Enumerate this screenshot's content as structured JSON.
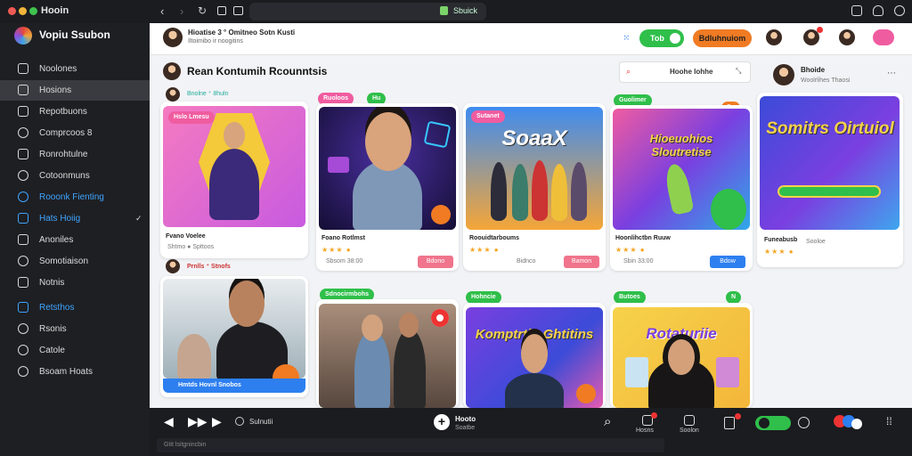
{
  "window": {
    "app_name": "Hooin",
    "url_label": "Sbuick"
  },
  "sidebar": {
    "title": "Vopiu Ssubon",
    "items": [
      {
        "label": "Noolones"
      },
      {
        "label": "Hosions"
      },
      {
        "label": "Repotbuons"
      },
      {
        "label": "Comprcoos 8"
      },
      {
        "label": "Ronrohtulne"
      },
      {
        "label": "Cotoonmuns"
      },
      {
        "label": "Rooonk Fienting"
      },
      {
        "label": "Hats Hoiig"
      },
      {
        "label": "Anoniles"
      },
      {
        "label": "Somotiaison"
      },
      {
        "label": "Notnis"
      },
      {
        "label": "Retsthos"
      },
      {
        "label": "Rsonis"
      },
      {
        "label": "Catole"
      },
      {
        "label": "Bsoam Hoats"
      }
    ]
  },
  "header": {
    "channel_title": "Hioatise 3 ° Omitneo Sotn Kusti",
    "channel_sub": "Iltoimibo ir noogitins",
    "toggle_label": "Tob",
    "cta_label": "Bdluhnuiom"
  },
  "section": {
    "title": "Rean Kontumih Rcounntsis",
    "subtitle": "Bnolne ⁺ 8huln",
    "search_placeholder": "Hoohe Iohhe",
    "row2_label": "Prnlls ⁺ Stnofs"
  },
  "profile": {
    "name": "Bhoide",
    "sub": "Woolrlihes Thaosi"
  },
  "cards": [
    {
      "tag": "Hslo Lmesu",
      "title": "Fvano Voelee",
      "meta": "Shtmo   ● Spttoos",
      "button": ""
    },
    {
      "tag": "Ruoloos",
      "tag2": "Hu",
      "title": "Foano Rotlmst",
      "meta": "Sbsom  38:00",
      "button": "Bdono",
      "poster": ""
    },
    {
      "tag": "Sutanet",
      "title": "Roouidtarboums",
      "meta": "Bidnco",
      "button": "Bamon",
      "poster": "SoaaX"
    },
    {
      "tag": "Guolimer",
      "tag2": "Sa",
      "title": "Hoonlihctbn Ruuw",
      "meta": "Sbin  33:00",
      "button": "Bdow",
      "poster": "Hioeuohios Sloutretise"
    },
    {
      "tag": "",
      "title": "Funeabusb",
      "meta": "Sooloe",
      "button": "",
      "poster": "Somitrs Oirtuiol"
    },
    {
      "tag": "",
      "title": "Hmtds  Hovnl  Snobos",
      "meta": "",
      "button": "",
      "poster": ""
    },
    {
      "tag": "Sdnocirmbohs",
      "title": "",
      "meta": "",
      "button": "",
      "poster": ""
    },
    {
      "tag": "Hohncie",
      "title": "",
      "meta": "",
      "button": "",
      "poster": "Komptrtin Ghtitins"
    },
    {
      "tag": "Butoes",
      "tag2": "N",
      "title": "",
      "meta": "",
      "button": "",
      "poster": "Rotaturiie"
    }
  ],
  "player": {
    "track": "Sulnutii",
    "now_title": "Hooto",
    "now_sub": "Soatbe",
    "status": "Gtit lsitgnincbin",
    "btn1": "Hosns",
    "btn2": "Soolon"
  },
  "colors": {
    "accent_green": "#2fbf4a",
    "accent_orange": "#f07b23",
    "accent_blue": "#2d7ff0",
    "pink": "#f05ca0"
  }
}
